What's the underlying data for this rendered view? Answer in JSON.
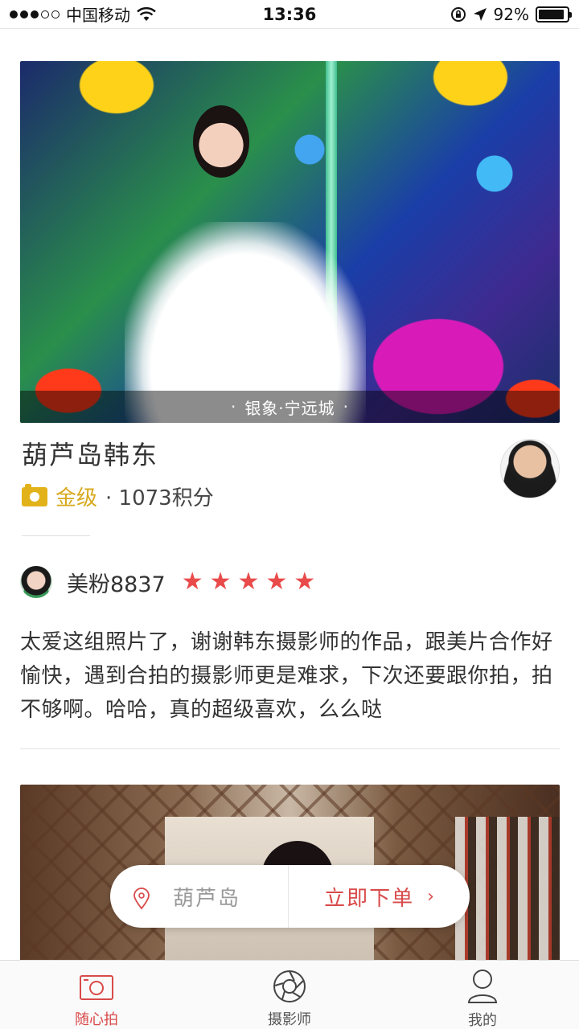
{
  "status_bar": {
    "carrier": "中国移动",
    "time": "13:36",
    "battery": "92%",
    "battery_level": 0.92,
    "signal_filled": 3,
    "signal_total": 5
  },
  "post": {
    "location_caption": "银象·宁远城",
    "caption_bullet": "·",
    "photographer_name": "葫芦岛韩东",
    "level": "金级",
    "points": "· 1073积分"
  },
  "review": {
    "reviewer": "美粉8837",
    "rating": 5,
    "text": "太爱这组照片了，谢谢韩东摄影师的作品，跟美片合作好愉快，遇到合拍的摄影师更是难求，下次还要跟你拍，拍不够啊。哈哈，真的超级喜欢，么么哒"
  },
  "float_bar": {
    "city": "葫芦岛",
    "order_label": "立即下单",
    "chevron": "›"
  },
  "tabs": [
    {
      "label": "随心拍",
      "icon": "camera-icon",
      "active": true
    },
    {
      "label": "摄影师",
      "icon": "aperture-icon",
      "active": false
    },
    {
      "label": "我的",
      "icon": "user-icon",
      "active": false
    }
  ],
  "colors": {
    "accent": "#d94a4a",
    "star": "#e94b4b",
    "gold": "#d7a91d"
  }
}
